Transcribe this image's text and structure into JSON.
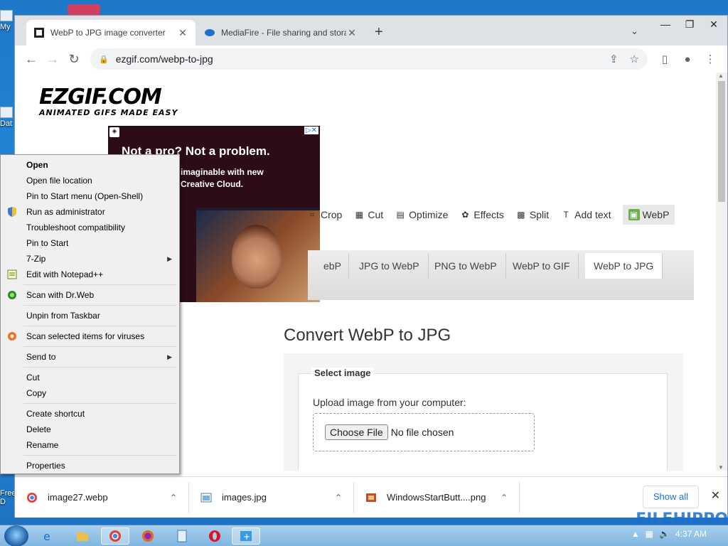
{
  "desktop": {
    "icons": [
      {
        "label": "My"
      },
      {
        "label": "Dat"
      },
      {
        "label": "Free D"
      }
    ],
    "watermark": "FILEHIPPO"
  },
  "browser": {
    "tabs": [
      {
        "title": "WebP to JPG image converter",
        "icon": "ezgif-icon"
      },
      {
        "title": "MediaFire - File sharing and stora",
        "icon": "mediafire-icon"
      }
    ],
    "new_tab_symbol": "+",
    "window_controls": {
      "minimize": "—",
      "maximize": "❐",
      "close": "✕"
    },
    "url": "ezgif.com/webp-to-jpg"
  },
  "page": {
    "logo": {
      "title": "EZGIF.COM",
      "tagline": "ANIMATED GIFS MADE EASY"
    },
    "ad": {
      "headline": "Not a pro? Not a problem.",
      "body_line1": "imaginable with new",
      "body_line2": "Creative Cloud.",
      "badge": "▷✕"
    },
    "tools": [
      {
        "label": "Crop",
        "icon": "crop-icon"
      },
      {
        "label": "Cut",
        "icon": "cut-icon"
      },
      {
        "label": "Optimize",
        "icon": "optimize-icon"
      },
      {
        "label": "Effects",
        "icon": "effects-icon"
      },
      {
        "label": "Split",
        "icon": "split-icon"
      },
      {
        "label": "Add text",
        "icon": "text-icon"
      },
      {
        "label": "WebP",
        "icon": "webp-icon",
        "active": true
      }
    ],
    "subtabs": [
      {
        "label": "ebP"
      },
      {
        "label": "JPG to WebP"
      },
      {
        "label": "PNG to WebP"
      },
      {
        "label": "WebP to GIF"
      },
      {
        "label": "WebP to JPG",
        "active": true
      }
    ],
    "heading": "Convert WebP to JPG",
    "form": {
      "legend": "Select image",
      "upload_label": "Upload image from your computer:",
      "choose_button": "Choose File",
      "file_status": "No file chosen"
    }
  },
  "downloads": {
    "items": [
      {
        "name": "image27.webp",
        "icon": "chrome-icon"
      },
      {
        "name": "images.jpg",
        "icon": "image-file-icon"
      },
      {
        "name": "WindowsStartButt....png",
        "icon": "png-file-icon"
      }
    ],
    "show_all": "Show all"
  },
  "context_menu": {
    "items": [
      {
        "label": "Open",
        "bold": true
      },
      {
        "label": "Open file location"
      },
      {
        "label": "Pin to Start menu (Open-Shell)"
      },
      {
        "label": "Run as administrator",
        "icon": "shield-icon"
      },
      {
        "label": "Troubleshoot compatibility"
      },
      {
        "label": "Pin to Start"
      },
      {
        "label": "7-Zip",
        "submenu": true
      },
      {
        "label": "Edit with Notepad++",
        "icon": "notepad-icon"
      },
      {
        "label": "Scan with Dr.Web",
        "icon": "drweb-icon"
      },
      {
        "label": "Unpin from Taskbar"
      },
      {
        "label": "Scan selected items for viruses",
        "icon": "avast-icon"
      },
      {
        "label": "Send to",
        "submenu": true
      },
      {
        "label": "Cut"
      },
      {
        "label": "Copy"
      },
      {
        "label": "Create shortcut"
      },
      {
        "label": "Delete"
      },
      {
        "label": "Rename"
      },
      {
        "label": "Properties"
      }
    ]
  },
  "taskbar": {
    "clock": "4:37 AM"
  }
}
